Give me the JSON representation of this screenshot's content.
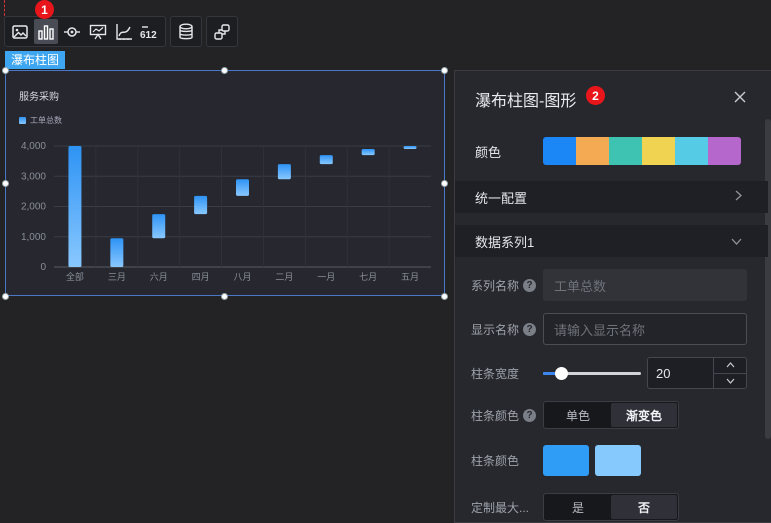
{
  "toolbar": {
    "badge": "1",
    "buttons": [
      {
        "name": "image-icon"
      },
      {
        "name": "bar-chart-icon",
        "active": true
      },
      {
        "name": "eye-icon"
      },
      {
        "name": "presentation-icon"
      },
      {
        "name": "axis-chart-icon"
      },
      {
        "name": "number-icon",
        "text": "612"
      },
      {
        "name": "database-icon"
      },
      {
        "name": "link-icon"
      }
    ]
  },
  "component": {
    "tag": "瀑布柱图"
  },
  "chart_data": {
    "type": "bar",
    "title": "服务采购",
    "legend": [
      "工单总数"
    ],
    "legend_position": "top-left",
    "categories": [
      "全部",
      "三月",
      "六月",
      "四月",
      "八月",
      "二月",
      "一月",
      "七月",
      "五月"
    ],
    "base": [
      0,
      0,
      950,
      1750,
      2350,
      2900,
      3400,
      3700,
      3900
    ],
    "values": [
      4000,
      950,
      800,
      600,
      550,
      500,
      300,
      200,
      100
    ],
    "ylim": [
      0,
      4000
    ],
    "yticks": [
      "0",
      "1,000",
      "2,000",
      "3,000",
      "4,000"
    ],
    "grid": true,
    "colors": [
      "#2e93f4",
      "#89c8ff"
    ]
  },
  "panel": {
    "title": "瀑布柱图-图形",
    "badge": "2",
    "close_icon": "close-icon",
    "color_label": "颜色",
    "palette": [
      "#1b86f5",
      "#f4a953",
      "#3ec3b3",
      "#f0d451",
      "#55cbe6",
      "#b667cc"
    ],
    "section_global": "统一配置",
    "section_series": "数据系列1",
    "series_name_label": "系列名称",
    "series_name_value": "工单总数",
    "display_name_label": "显示名称",
    "display_name_placeholder": "请输入显示名称",
    "bar_width_label": "柱条宽度",
    "bar_width_value": "20",
    "bar_width_fraction": 0.18,
    "bar_color_mode_label": "柱条颜色",
    "bar_color_mode_options": [
      "单色",
      "渐变色"
    ],
    "bar_color_mode_selected": 1,
    "bar_color_label": "柱条颜色",
    "bar_colors": [
      "#2f9cf5",
      "#86cafd"
    ],
    "custom_max_label": "定制最大...",
    "custom_max_options": [
      "是",
      "否"
    ],
    "custom_max_selected": 1
  }
}
